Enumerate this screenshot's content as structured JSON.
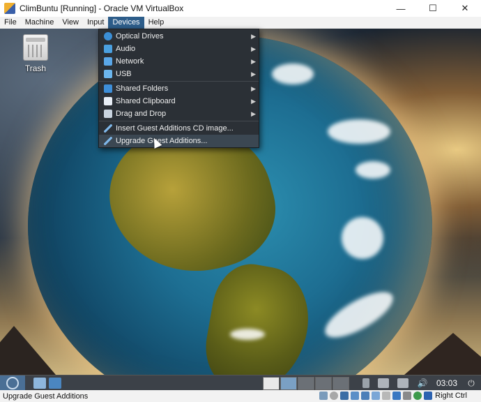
{
  "window": {
    "title": "ClimBuntu [Running] - Oracle VM VirtualBox",
    "controls": {
      "minimize": "—",
      "maximize": "☐",
      "close": "✕"
    }
  },
  "menubar": {
    "items": [
      "File",
      "Machine",
      "View",
      "Input",
      "Devices",
      "Help"
    ],
    "active": "Devices"
  },
  "desktop": {
    "icons": [
      {
        "label": "Trash",
        "icon": "trash-icon"
      }
    ]
  },
  "devices_menu": {
    "items": [
      {
        "label": "Optical Drives",
        "icon": "optical-disc-icon",
        "submenu": true
      },
      {
        "label": "Audio",
        "icon": "audio-icon",
        "submenu": true
      },
      {
        "label": "Network",
        "icon": "network-icon",
        "submenu": true
      },
      {
        "label": "USB",
        "icon": "usb-icon",
        "submenu": true
      },
      {
        "label": "Shared Folders",
        "icon": "shared-folder-icon",
        "submenu": true
      },
      {
        "label": "Shared Clipboard",
        "icon": "clipboard-icon",
        "submenu": true
      },
      {
        "label": "Drag and Drop",
        "icon": "drag-drop-icon",
        "submenu": true
      },
      {
        "label": "Insert Guest Additions CD image...",
        "icon": "wrench-icon",
        "submenu": false
      },
      {
        "label": "Upgrade Guest Additions...",
        "icon": "wrench-icon",
        "submenu": false,
        "highlighted": true
      }
    ]
  },
  "panel": {
    "clock": "03:03"
  },
  "statusbar": {
    "message": "Upgrade Guest Additions",
    "host_key": "Right Ctrl"
  }
}
